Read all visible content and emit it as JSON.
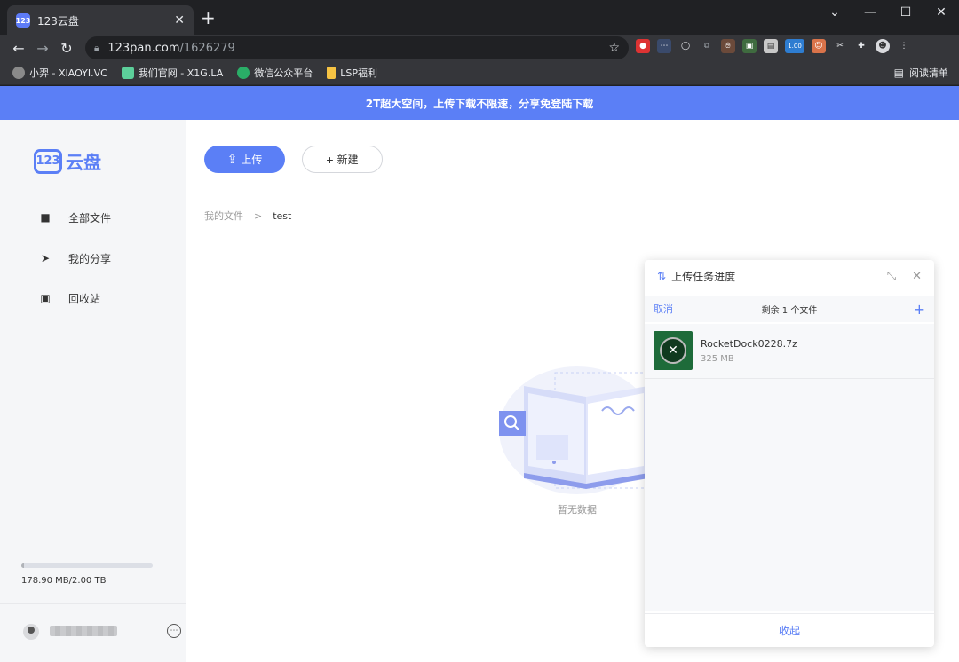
{
  "browser": {
    "tab_title": "123云盘",
    "favicon_label": "123",
    "close_glyph": "✕",
    "new_tab_glyph": "+",
    "window_controls": [
      "⌄",
      "—",
      "☐",
      "✕"
    ],
    "url_host": "123pan.com",
    "url_path": "/1626279",
    "extension_badge": "1.00",
    "bookmarks": [
      {
        "label": "小羿 - XIAOYI.VC",
        "icon_color": "#8a8a8a"
      },
      {
        "label": "我们官网 - X1G.LA",
        "icon_color": "#5ccf9a"
      },
      {
        "label": "微信公众平台",
        "icon_color": "#2aae67"
      },
      {
        "label": "LSP福利",
        "icon_color": "#f6c343"
      }
    ],
    "reading_list": "阅读清单"
  },
  "banner": {
    "text": "2T超大空间，上传下载不限速，分享免登陆下载"
  },
  "sidebar": {
    "logo_badge": "123",
    "logo_text": "云盘",
    "items": [
      {
        "label": "全部文件",
        "icon": "folder-icon"
      },
      {
        "label": "我的分享",
        "icon": "send-icon"
      },
      {
        "label": "回收站",
        "icon": "trash-icon"
      }
    ],
    "storage_text": "178.90 MB/2.00 TB",
    "storage_used_fraction": 9e-05
  },
  "main": {
    "upload_label": "上传",
    "new_label": "新建",
    "breadcrumb_root": "我的文件",
    "breadcrumb_sep": ">",
    "breadcrumb_current": "test",
    "empty_text": "暂无数据"
  },
  "upload_panel": {
    "title": "上传任务进度",
    "cancel": "取消",
    "remaining": "剩余 1 个文件",
    "file_name": "RocketDock0228.7z",
    "file_size": "325 MB",
    "collapse": "收起"
  },
  "colors": {
    "accent": "#5b7ff6",
    "thumb": "#1e6b3a"
  }
}
